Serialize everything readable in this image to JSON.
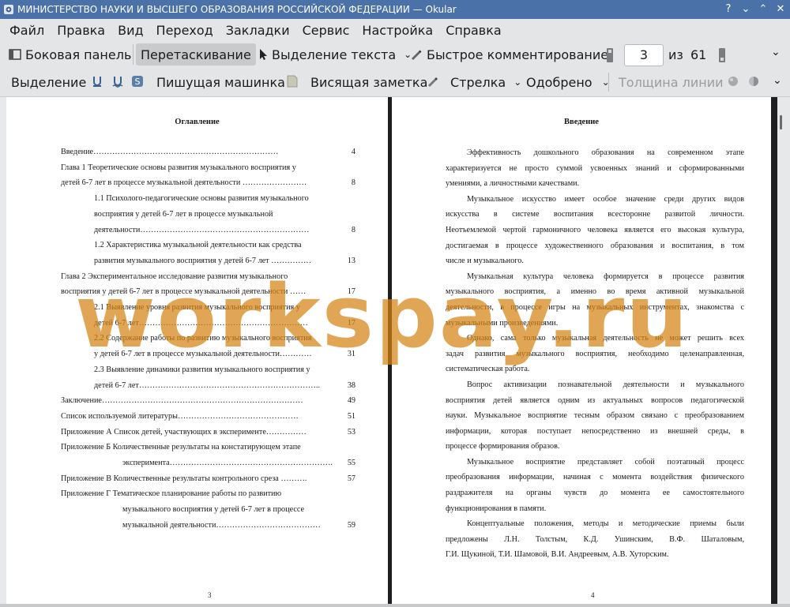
{
  "window": {
    "title": "МИНИСТЕРСТВО НАУКИ И ВЫСШЕГО ОБРАЗОВАНИЯ РОССИЙСКОЙ ФЕДЕРАЦИИ — Okular",
    "accent": "#4a72a8"
  },
  "menu": [
    "Файл",
    "Правка",
    "Вид",
    "Переход",
    "Закладки",
    "Сервис",
    "Настройка",
    "Справка"
  ],
  "toolbar": {
    "sidebar": "Боковая панель",
    "drag": "Перетаскивание",
    "text_select": "Выделение текста",
    "quick_comment": "Быстрое комментирование",
    "page_current": "3",
    "page_of": "из",
    "page_total": "61"
  },
  "annot_toolbar": {
    "selection": "Выделение",
    "typewriter": "Пишущая машинка",
    "hanging_note": "Висящая заметка",
    "arrow": "Стрелка",
    "approved": "Одобрено",
    "line_width": "Толщина линии"
  },
  "watermark": "workspay.ru",
  "left_page": {
    "heading": "Оглавление",
    "page_number": "3",
    "toc": [
      {
        "text": "Введение……………………………………………………………",
        "page": "4"
      },
      {
        "text": "Глава 1 Теоретические основы развития музыкального восприятия у",
        "page": ""
      },
      {
        "text": "детей 6-7 лет в процессе музыкальной деятельности ……………………",
        "page": "8"
      },
      {
        "text": "1.1 Психолого-педагогические основы развития музыкального",
        "page": ""
      },
      {
        "text": "восприятия у детей 6-7 лет в процессе музыкальной",
        "page": ""
      },
      {
        "text": "деятельности………………………………………………………",
        "page": "8"
      },
      {
        "text": "1.2 Характеристика музыкальной деятельности как средства",
        "page": ""
      },
      {
        "text": "развития музыкального восприятия у детей 6-7 лет ……………",
        "page": "13"
      },
      {
        "text": "Глава 2 Экспериментальное исследование развития музыкального",
        "page": ""
      },
      {
        "text": "восприятия у детей 6-7 лет в процессе музыкальной деятельности ……",
        "page": "17"
      },
      {
        "text": "2.1 Выявление уровня развития музыкального восприятия у",
        "page": ""
      },
      {
        "text": "детей 6-7 лет………………………………………………………",
        "page": "17"
      },
      {
        "text": "2.2 Содержание работы по развитию музыкального восприятия",
        "page": ""
      },
      {
        "text": "у детей 6-7 лет в процессе музыкальной деятельности…………",
        "page": "31"
      },
      {
        "text": "2.3 Выявление динамики развития музыкального восприятия у",
        "page": ""
      },
      {
        "text": "детей 6-7 лет…………………………………………………………..",
        "page": "38"
      },
      {
        "text": "Заключение…………………………………………………………………",
        "page": "49"
      },
      {
        "text": "Список используемой литературы………………………………………",
        "page": "51"
      },
      {
        "text": "Приложение А Список детей, участвующих в эксперименте……………",
        "page": "53"
      },
      {
        "text": "Приложение Б Количественные результаты на констатирующем этапе",
        "page": ""
      },
      {
        "text": "эксперимента…………………………………………………….",
        "page": "55"
      },
      {
        "text": "Приложение В Количественные результаты контрольного среза ……….",
        "page": "57"
      },
      {
        "text": "Приложение Г Тематическое планирование работы по развитию",
        "page": ""
      },
      {
        "text": "музыкального восприятия у детей 6-7 лет в процессе",
        "page": ""
      },
      {
        "text": "музыкальной деятельности…………………………………",
        "page": "59"
      }
    ]
  },
  "right_page": {
    "heading": "Введение",
    "page_number": "4",
    "lines": [
      "Эффективность дошкольного образования на современном этапе",
      "характеризуется не просто суммой усвоенных знаний и сформированными",
      "умениями, а личностными качествами.",
      "Музыкальное искусство имеет особое значение среди других видов",
      "искусства в системе воспитания всесторонне развитой личности.",
      "Неотъемлемой чертой гармоничного человека является его высокая культура,",
      "достигаемая в процессе художественного образования и воспитания, в том",
      "числе и музыкального.",
      "Музыкальная культура человека формируется в процессе развития",
      "музыкального восприятия, а именно во время активной музыкальной",
      "деятельности, в процессе игры на музыкальных инструментах, знакомства с",
      "музыкальными произведениями.",
      "Однако, сама только музыкальная деятельность не может решить всех",
      "задач развития музыкального восприятия, необходимо целенаправленная,",
      "систематическая работа.",
      "Вопрос активизации познавательной деятельности и музыкального",
      "восприятия детей является одним из актуальных вопросов педагогической",
      "науки. Музыкальное восприятие тесным образом связано с преобразованием",
      "информации, которая поступает непосредственно из внешней среды, в",
      "процессе формирования образов.",
      "Музыкальное восприятие представляет собой поэтапный процесс",
      "преобразования информации, начиная с момента воздействия физического",
      "раздражителя на органы чувств до момента ее самостоятельного",
      "функционирования в памяти.",
      "Концептуальные положения, методы и методические приемы были",
      "предложены Л.Н. Толстым, К.Д. Ушинским, В.Ф. Шаталовым,",
      "Г.И. Щукиной, Т.И. Шамовой, В.И. Андреевым, А.В. Хуторским."
    ]
  }
}
